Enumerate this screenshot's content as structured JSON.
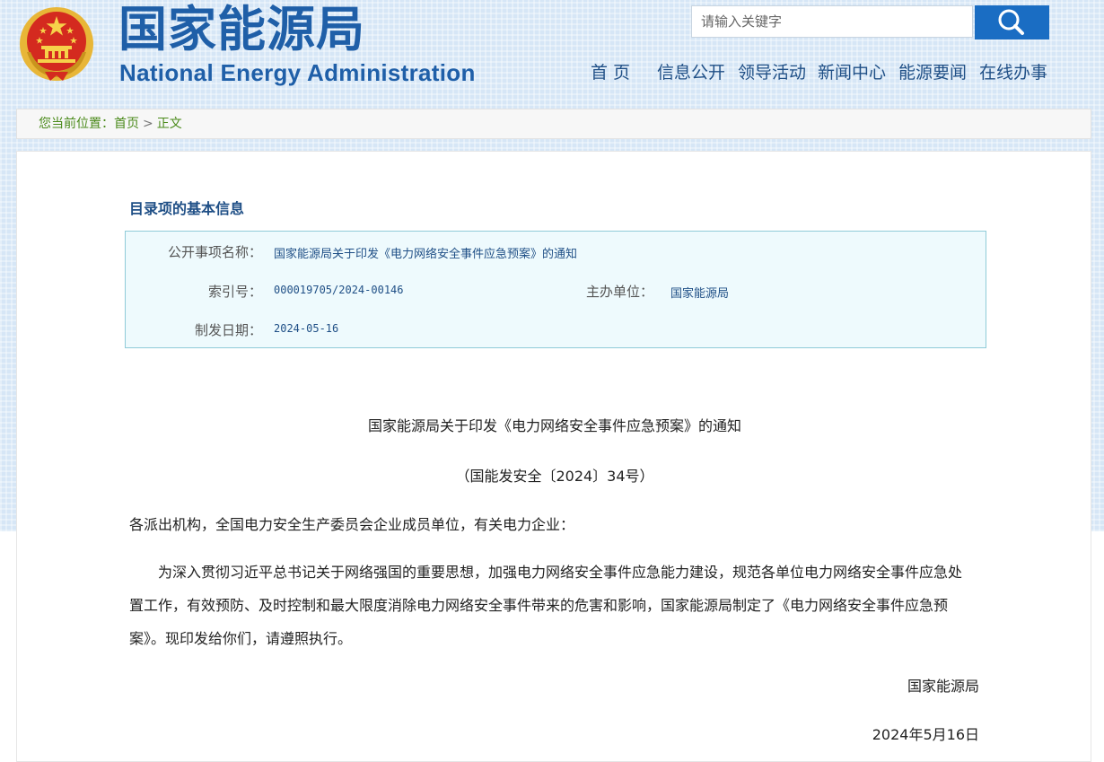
{
  "header": {
    "title_cn": "国家能源局",
    "title_en": "National Energy Administration",
    "search": {
      "placeholder": "请输入关键字"
    },
    "nav": [
      "首 页",
      "信息公开",
      "领导活动",
      "新闻中心",
      "能源要闻",
      "在线办事"
    ]
  },
  "breadcrumb": {
    "prefix": "您当前位置：",
    "items": [
      "首页",
      "正文"
    ],
    "separator": ">"
  },
  "info": {
    "heading": "目录项的基本信息",
    "name_label": "公开事项名称：",
    "name_value": "国家能源局关于印发《电力网络安全事件应急预案》的通知",
    "index_label": "索引号：",
    "index_value": "000019705/2024-00146",
    "unit_label": "主办单位：",
    "unit_value": "国家能源局",
    "date_label": "制发日期：",
    "date_value": "2024-05-16"
  },
  "document": {
    "title": "国家能源局关于印发《电力网络安全事件应急预案》的通知",
    "number": "（国能发安全〔2024〕34号）",
    "salutation": "各派出机构，全国电力安全生产委员会企业成员单位，有关电力企业：",
    "paragraph": "为深入贯彻习近平总书记关于网络强国的重要思想，加强电力网络安全事件应急能力建设，规范各单位电力网络安全事件应急处置工作，有效预防、及时控制和最大限度消除电力网络安全事件带来的危害和影响，国家能源局制定了《电力网络安全事件应急预案》。现印发给你们，请遵照执行。",
    "signature": "国家能源局",
    "date": "2024年5月16日"
  },
  "icons": {
    "emblem": "national-emblem-icon",
    "search": "search-icon"
  },
  "colors": {
    "brand_blue": "#1f5fa8",
    "search_button": "#1a6dc3",
    "nav_text": "#1f4f86",
    "breadcrumb_text": "#4a8a1a",
    "info_box_bg": "#eefafd",
    "info_box_border": "#8fcbd8"
  }
}
